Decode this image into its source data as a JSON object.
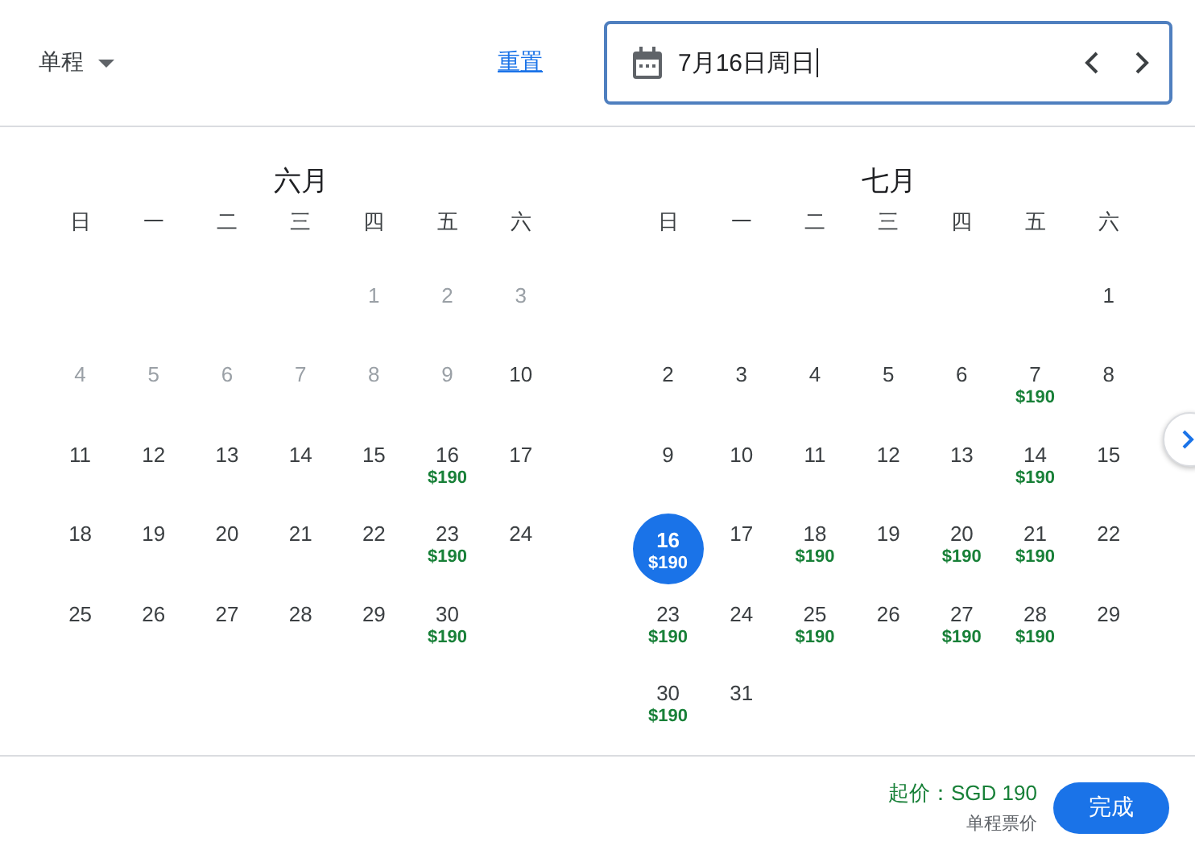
{
  "trip_type": {
    "label": "单程"
  },
  "reset_link": "重置",
  "date_field": {
    "value": "7月16日周日"
  },
  "months": [
    {
      "title": "六月",
      "weekdays": [
        "日",
        "一",
        "二",
        "三",
        "四",
        "五",
        "六"
      ],
      "weeks": [
        [
          {
            "kind": "blank"
          },
          {
            "kind": "blank"
          },
          {
            "kind": "blank"
          },
          {
            "kind": "blank"
          },
          {
            "kind": "day",
            "day": "1",
            "disabled": true,
            "selected": false
          },
          {
            "kind": "day",
            "day": "2",
            "disabled": true,
            "selected": false
          },
          {
            "kind": "day",
            "day": "3",
            "disabled": true,
            "selected": false
          }
        ],
        [
          {
            "kind": "day",
            "day": "4",
            "disabled": true,
            "selected": false
          },
          {
            "kind": "day",
            "day": "5",
            "disabled": true,
            "selected": false
          },
          {
            "kind": "day",
            "day": "6",
            "disabled": true,
            "selected": false
          },
          {
            "kind": "day",
            "day": "7",
            "disabled": true,
            "selected": false
          },
          {
            "kind": "day",
            "day": "8",
            "disabled": true,
            "selected": false
          },
          {
            "kind": "day",
            "day": "9",
            "disabled": true,
            "selected": false
          },
          {
            "kind": "day",
            "day": "10",
            "disabled": false,
            "selected": false
          }
        ],
        [
          {
            "kind": "day",
            "day": "11",
            "disabled": false,
            "selected": false
          },
          {
            "kind": "day",
            "day": "12",
            "disabled": false,
            "selected": false
          },
          {
            "kind": "day",
            "day": "13",
            "disabled": false,
            "selected": false
          },
          {
            "kind": "day",
            "day": "14",
            "disabled": false,
            "selected": false
          },
          {
            "kind": "day",
            "day": "15",
            "disabled": false,
            "selected": false
          },
          {
            "kind": "day",
            "day": "16",
            "price": "$190",
            "disabled": false,
            "selected": false
          },
          {
            "kind": "day",
            "day": "17",
            "disabled": false,
            "selected": false
          }
        ],
        [
          {
            "kind": "day",
            "day": "18",
            "disabled": false,
            "selected": false
          },
          {
            "kind": "day",
            "day": "19",
            "disabled": false,
            "selected": false
          },
          {
            "kind": "day",
            "day": "20",
            "disabled": false,
            "selected": false
          },
          {
            "kind": "day",
            "day": "21",
            "disabled": false,
            "selected": false
          },
          {
            "kind": "day",
            "day": "22",
            "disabled": false,
            "selected": false
          },
          {
            "kind": "day",
            "day": "23",
            "price": "$190",
            "disabled": false,
            "selected": false
          },
          {
            "kind": "day",
            "day": "24",
            "disabled": false,
            "selected": false
          }
        ],
        [
          {
            "kind": "day",
            "day": "25",
            "disabled": false,
            "selected": false
          },
          {
            "kind": "day",
            "day": "26",
            "disabled": false,
            "selected": false
          },
          {
            "kind": "day",
            "day": "27",
            "disabled": false,
            "selected": false
          },
          {
            "kind": "day",
            "day": "28",
            "disabled": false,
            "selected": false
          },
          {
            "kind": "day",
            "day": "29",
            "disabled": false,
            "selected": false
          },
          {
            "kind": "day",
            "day": "30",
            "price": "$190",
            "disabled": false,
            "selected": false
          },
          {
            "kind": "blank"
          }
        ]
      ]
    },
    {
      "title": "七月",
      "weekdays": [
        "日",
        "一",
        "二",
        "三",
        "四",
        "五",
        "六"
      ],
      "weeks": [
        [
          {
            "kind": "blank"
          },
          {
            "kind": "blank"
          },
          {
            "kind": "blank"
          },
          {
            "kind": "blank"
          },
          {
            "kind": "blank"
          },
          {
            "kind": "blank"
          },
          {
            "kind": "day",
            "day": "1",
            "disabled": false,
            "selected": false
          }
        ],
        [
          {
            "kind": "day",
            "day": "2",
            "disabled": false,
            "selected": false
          },
          {
            "kind": "day",
            "day": "3",
            "disabled": false,
            "selected": false
          },
          {
            "kind": "day",
            "day": "4",
            "disabled": false,
            "selected": false
          },
          {
            "kind": "day",
            "day": "5",
            "disabled": false,
            "selected": false
          },
          {
            "kind": "day",
            "day": "6",
            "disabled": false,
            "selected": false
          },
          {
            "kind": "day",
            "day": "7",
            "price": "$190",
            "disabled": false,
            "selected": false
          },
          {
            "kind": "day",
            "day": "8",
            "disabled": false,
            "selected": false
          }
        ],
        [
          {
            "kind": "day",
            "day": "9",
            "disabled": false,
            "selected": false
          },
          {
            "kind": "day",
            "day": "10",
            "disabled": false,
            "selected": false
          },
          {
            "kind": "day",
            "day": "11",
            "disabled": false,
            "selected": false
          },
          {
            "kind": "day",
            "day": "12",
            "disabled": false,
            "selected": false
          },
          {
            "kind": "day",
            "day": "13",
            "disabled": false,
            "selected": false
          },
          {
            "kind": "day",
            "day": "14",
            "price": "$190",
            "disabled": false,
            "selected": false
          },
          {
            "kind": "day",
            "day": "15",
            "disabled": false,
            "selected": false
          }
        ],
        [
          {
            "kind": "day",
            "day": "16",
            "price": "$190",
            "disabled": false,
            "selected": true
          },
          {
            "kind": "day",
            "day": "17",
            "disabled": false,
            "selected": false
          },
          {
            "kind": "day",
            "day": "18",
            "price": "$190",
            "disabled": false,
            "selected": false
          },
          {
            "kind": "day",
            "day": "19",
            "disabled": false,
            "selected": false
          },
          {
            "kind": "day",
            "day": "20",
            "price": "$190",
            "disabled": false,
            "selected": false
          },
          {
            "kind": "day",
            "day": "21",
            "price": "$190",
            "disabled": false,
            "selected": false
          },
          {
            "kind": "day",
            "day": "22",
            "disabled": false,
            "selected": false
          }
        ],
        [
          {
            "kind": "day",
            "day": "23",
            "price": "$190",
            "disabled": false,
            "selected": false
          },
          {
            "kind": "day",
            "day": "24",
            "disabled": false,
            "selected": false
          },
          {
            "kind": "day",
            "day": "25",
            "price": "$190",
            "disabled": false,
            "selected": false
          },
          {
            "kind": "day",
            "day": "26",
            "disabled": false,
            "selected": false
          },
          {
            "kind": "day",
            "day": "27",
            "price": "$190",
            "disabled": false,
            "selected": false
          },
          {
            "kind": "day",
            "day": "28",
            "price": "$190",
            "disabled": false,
            "selected": false
          },
          {
            "kind": "day",
            "day": "29",
            "disabled": false,
            "selected": false
          }
        ],
        [
          {
            "kind": "day",
            "day": "30",
            "price": "$190",
            "disabled": false,
            "selected": false
          },
          {
            "kind": "day",
            "day": "31",
            "disabled": false,
            "selected": false
          },
          {
            "kind": "blank"
          },
          {
            "kind": "blank"
          },
          {
            "kind": "blank"
          },
          {
            "kind": "blank"
          },
          {
            "kind": "blank"
          }
        ]
      ]
    }
  ],
  "footer": {
    "price": "起价：SGD 190",
    "price_note": "单程票价",
    "done_button": "完成"
  }
}
